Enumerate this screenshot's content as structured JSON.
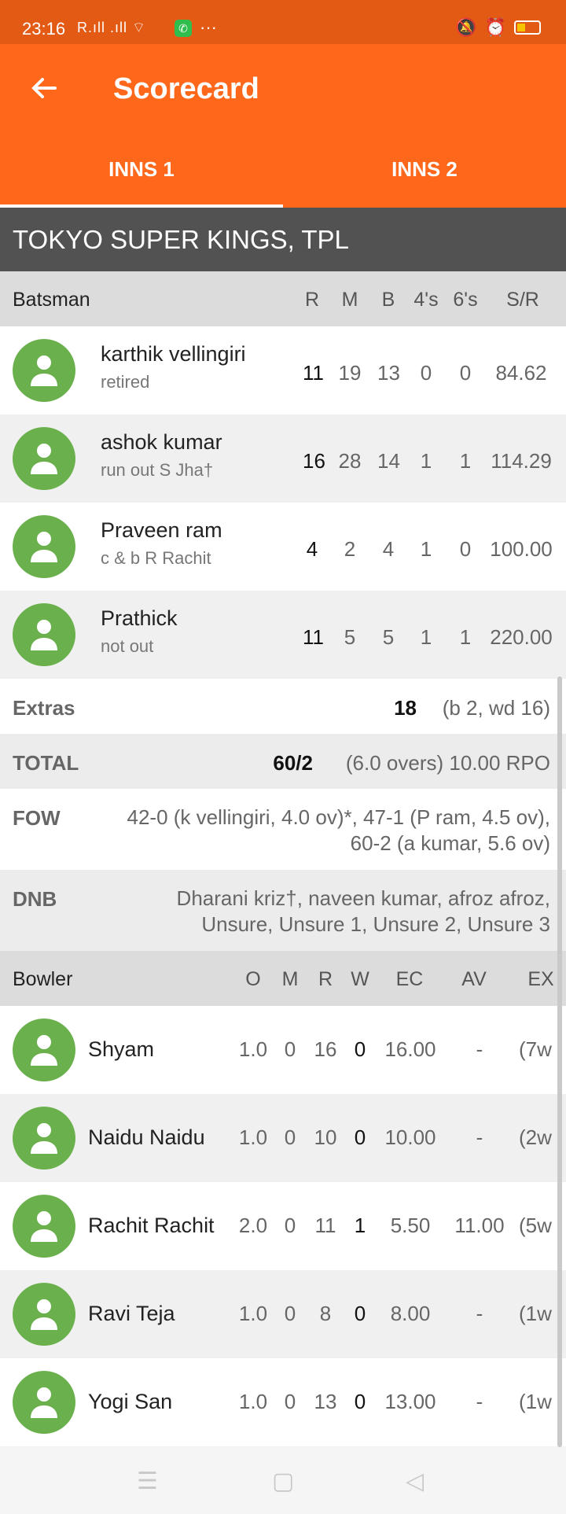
{
  "status_bar": {
    "time": "23:16",
    "signal": "R.ıll .ıll ⌔",
    "more": "···"
  },
  "app_bar": {
    "title": "Scorecard",
    "back_icon": "arrow-left-icon"
  },
  "tabs": [
    {
      "label": "INNS 1",
      "selected": true
    },
    {
      "label": "INNS 2",
      "selected": false
    }
  ],
  "team_name": "TOKYO SUPER KINGS, TPL",
  "batting": {
    "header": {
      "label": "Batsman",
      "cols": [
        "R",
        "M",
        "B",
        "4's",
        "6's",
        "S/R"
      ]
    },
    "rows": [
      {
        "name": "karthik vellingiri",
        "desc": "retired",
        "r": "11",
        "m": "19",
        "b": "13",
        "fours": "0",
        "sixes": "0",
        "sr": "84.62"
      },
      {
        "name": "ashok kumar",
        "desc": "run out S Jha†",
        "r": "16",
        "m": "28",
        "b": "14",
        "fours": "1",
        "sixes": "1",
        "sr": "114.29"
      },
      {
        "name": "Praveen ram",
        "desc": "c & b R Rachit",
        "r": "4",
        "m": "2",
        "b": "4",
        "fours": "1",
        "sixes": "0",
        "sr": "100.00"
      },
      {
        "name": "Prathick",
        "desc": "not out",
        "r": "11",
        "m": "5",
        "b": "5",
        "fours": "1",
        "sixes": "1",
        "sr": "220.00"
      }
    ]
  },
  "extras": {
    "label": "Extras",
    "value": "18",
    "detail": "(b 2, wd 16)"
  },
  "total": {
    "label": "TOTAL",
    "value": "60/2",
    "detail": "(6.0 overs) 10.00 RPO"
  },
  "fow": {
    "label": "FOW",
    "line1": "42-0 (k vellingiri, 4.0 ov)*, 47-1 (P ram, 4.5 ov),",
    "line2": "60-2 (a kumar, 5.6 ov)"
  },
  "dnb": {
    "label": "DNB",
    "line1": "Dharani kriz†, naveen kumar, afroz afroz,",
    "line2": "Unsure, Unsure 1, Unsure 2, Unsure 3"
  },
  "bowling": {
    "header": {
      "label": "Bowler",
      "cols": [
        "O",
        "M",
        "R",
        "W",
        "EC",
        "AV",
        "EX"
      ]
    },
    "rows": [
      {
        "name": "Shyam",
        "o": "1.0",
        "m": "0",
        "r": "16",
        "w": "0",
        "ec": "16.00",
        "av": "-",
        "ex": "(7w"
      },
      {
        "name": "Naidu Naidu",
        "o": "1.0",
        "m": "0",
        "r": "10",
        "w": "0",
        "ec": "10.00",
        "av": "-",
        "ex": "(2w"
      },
      {
        "name": "Rachit Rachit",
        "o": "2.0",
        "m": "0",
        "r": "11",
        "w": "1",
        "ec": "5.50",
        "av": "11.00",
        "ex": "(5w"
      },
      {
        "name": "Ravi Teja",
        "o": "1.0",
        "m": "0",
        "r": "8",
        "w": "0",
        "ec": "8.00",
        "av": "-",
        "ex": "(1w"
      },
      {
        "name": "Yogi San",
        "o": "1.0",
        "m": "0",
        "r": "13",
        "w": "0",
        "ec": "13.00",
        "av": "-",
        "ex": "(1w"
      }
    ]
  },
  "colors": {
    "accent": "#ff671a",
    "avatar": "#6ab04c",
    "team_bar": "#525252"
  }
}
